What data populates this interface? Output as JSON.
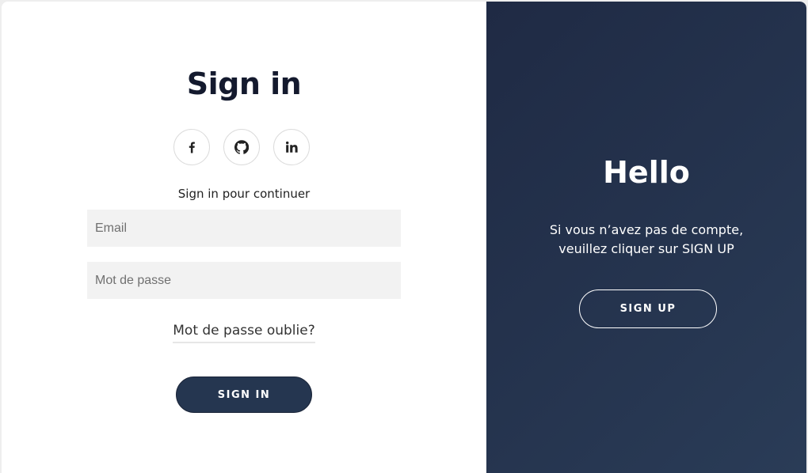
{
  "sign_in": {
    "title": "Sign in",
    "social_icons": [
      "facebook-icon",
      "github-icon",
      "linkedin-icon"
    ],
    "subtitle": "Sign in pour continuer",
    "email_placeholder": "Email",
    "password_placeholder": "Mot de passe",
    "forgot_label": "Mot de passe oublie?",
    "button_label": "SIGN IN"
  },
  "hello_panel": {
    "title": "Hello",
    "text_line1": "Si vous n’avez pas de compte,",
    "text_line2": "veuillez cliquer sur SIGN UP",
    "button_label": "SIGN UP"
  },
  "colors": {
    "panel_start": "#1f2a44",
    "panel_end": "#2a3c57",
    "button": "#253650",
    "title": "#141a2e",
    "input_bg": "#f2f2f2"
  }
}
